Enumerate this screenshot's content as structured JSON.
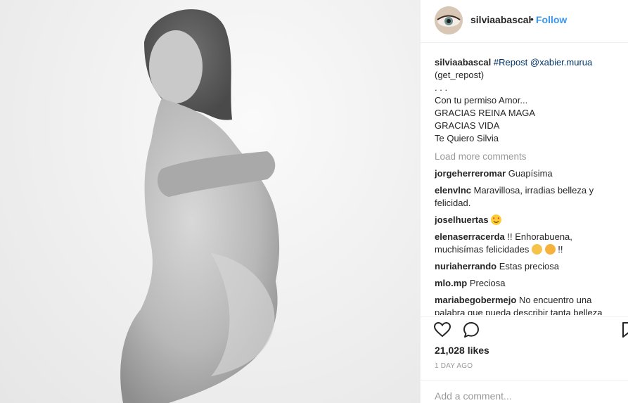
{
  "post": {
    "photo_alt": "Black and white photograph",
    "header": {
      "username": "silviaabascal",
      "separator": "•",
      "follow_label": "Follow"
    },
    "caption": {
      "username": "silviaabascal",
      "tag": "#Repost",
      "mention": "@xabier.murua",
      "lines": [
        "(get_repost)",
        ". . .",
        "Con tu permiso Amor...",
        "GRACIAS REINA MAGA",
        "GRACIAS VIDA",
        "Te Quiero Silvia"
      ]
    },
    "load_more": "Load more comments",
    "comments": [
      {
        "user": "jorgeherreromar",
        "text": "Guapísima"
      },
      {
        "user": "elenvlnc",
        "text": "Maravillosa, irradias belleza y felicidad."
      },
      {
        "user": "joselhuertas",
        "text": "",
        "emoji": "heart-eyes-emoji"
      },
      {
        "user": "elenaserracerda",
        "text": "!! Enhorabuena, muchisímas felicidades",
        "text_after": "!!"
      },
      {
        "user": "nuriaherrando",
        "text": "Estas preciosa"
      },
      {
        "user": "mlo.mp",
        "text": "Preciosa"
      },
      {
        "user": "mariabegobermejo",
        "text": "No encuentro una palabra que pueda describir tanta belleza"
      }
    ],
    "likes": "21,028 likes",
    "time": "1 DAY AGO",
    "add_comment_placeholder": "Add a comment..."
  },
  "icons": [
    "heart-icon",
    "comment-icon",
    "bookmark-icon"
  ],
  "colors": {
    "link": "#003569",
    "follow": "#3897f0",
    "muted": "#999999",
    "text": "#262626"
  }
}
